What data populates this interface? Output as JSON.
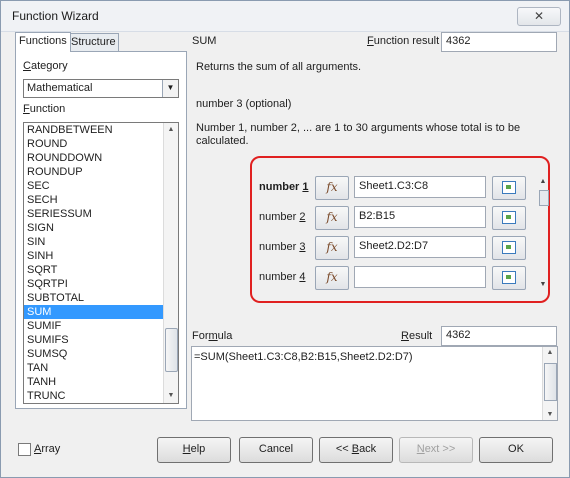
{
  "window": {
    "title": "Function Wizard",
    "close": "✕"
  },
  "tabs": {
    "functions": "Functions",
    "structure": "Structure"
  },
  "category": {
    "label": "Category",
    "value": "Mathematical"
  },
  "function_list": {
    "label": "Function",
    "items": [
      "RANDBETWEEN",
      "ROUND",
      "ROUNDDOWN",
      "ROUNDUP",
      "SEC",
      "SECH",
      "SERIESSUM",
      "SIGN",
      "SIN",
      "SINH",
      "SQRT",
      "SQRTPI",
      "SUBTOTAL",
      "SUM",
      "SUMIF",
      "SUMIFS",
      "SUMSQ",
      "TAN",
      "TANH",
      "TRUNC"
    ],
    "selected": "SUM"
  },
  "function_name": "SUM",
  "function_result": {
    "label": "Function result",
    "value": "4362"
  },
  "description": "Returns the sum of all arguments.",
  "current_argument": "number 3 (optional)",
  "argument_description_line1": "Number 1, number 2, ... are 1 to 30 arguments whose total is to be",
  "argument_description_line2": "calculated.",
  "arguments": [
    {
      "label": "number 1",
      "value": "Sheet1.C3:C8"
    },
    {
      "label": "number 2",
      "value": "B2:B15"
    },
    {
      "label": "number 3",
      "value": "Sheet2.D2:D7"
    },
    {
      "label": "number 4",
      "value": ""
    }
  ],
  "fx_label": "fx",
  "formula": {
    "label": "Formula",
    "value": "=SUM(Sheet1.C3:C8,B2:B15,Sheet2.D2:D7)"
  },
  "result": {
    "label": "Result",
    "value": "4362"
  },
  "array_label": "Array",
  "buttons": {
    "help": "Help",
    "cancel": "Cancel",
    "back": "<< Back",
    "next": "Next >>",
    "ok": "OK"
  },
  "colors": {
    "selection": "#3399ff",
    "highlight_border": "#e02020"
  }
}
